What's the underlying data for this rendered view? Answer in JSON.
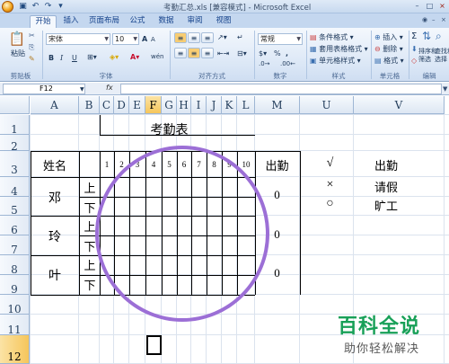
{
  "window": {
    "title": "考勤汇总.xls [兼容模式] - Microsoft Excel",
    "min": "–",
    "max": "□",
    "close": "×"
  },
  "quick_access": {
    "save": "▣",
    "undo": "↶",
    "redo": "↷",
    "more": "▾"
  },
  "tabs": [
    {
      "label": "开始",
      "active": true
    },
    {
      "label": "插入"
    },
    {
      "label": "页面布局"
    },
    {
      "label": "公式"
    },
    {
      "label": "数据"
    },
    {
      "label": "审阅"
    },
    {
      "label": "视图"
    }
  ],
  "ribbon": {
    "clipboard": {
      "paste": "粘贴",
      "label": "剪贴板"
    },
    "font": {
      "name": "宋体",
      "size": "10",
      "bold": "B",
      "italic": "I",
      "underline": "U",
      "grow": "A",
      "shrink": "A",
      "wen": "wén",
      "label": "字体"
    },
    "alignment": {
      "label": "对齐方式"
    },
    "number": {
      "format": "常规",
      "percent": "%",
      "comma": ",",
      "label": "数字"
    },
    "styles": {
      "conditional": "条件格式",
      "table": "套用表格格式",
      "cell": "单元格样式",
      "label": "样式"
    },
    "cells": {
      "insert": "插入",
      "delete": "删除",
      "format": "格式",
      "label": "单元格"
    },
    "editing": {
      "sigma": "Σ",
      "sort": "排序和\n筛选",
      "find": "查找和\n选择",
      "label": "编辑"
    }
  },
  "formula_bar": {
    "namebox": "F12",
    "fx": "fx",
    "value": ""
  },
  "columns": [
    "A",
    "B",
    "C",
    "D",
    "E",
    "F",
    "G",
    "H",
    "I",
    "J",
    "K",
    "L",
    "M",
    "U",
    "V"
  ],
  "selected_column": "F",
  "rows": [
    "1",
    "2",
    "3",
    "4",
    "5",
    "6",
    "7",
    "8",
    "9",
    "10",
    "11",
    "12"
  ],
  "selected_row": "12",
  "sheet": {
    "title": "考勤表",
    "name_header": "姓名",
    "days": [
      "1",
      "2",
      "3",
      "4",
      "5",
      "6",
      "7",
      "8",
      "9",
      "10"
    ],
    "total_header": "出勤",
    "people": [
      {
        "name": "邓",
        "am": "上",
        "pm": "下",
        "total": "0"
      },
      {
        "name": "玲",
        "am": "上",
        "pm": "下",
        "total": "0"
      },
      {
        "name": "叶",
        "am": "上",
        "pm": "下",
        "total": "0"
      }
    ],
    "legend": [
      {
        "symbol": "√",
        "meaning": "出勤"
      },
      {
        "symbol": "×",
        "meaning": "请假"
      },
      {
        "symbol": "○",
        "meaning": "旷工"
      }
    ]
  },
  "watermark": {
    "brand": "百科全说",
    "slogan": "助你轻松解决"
  }
}
